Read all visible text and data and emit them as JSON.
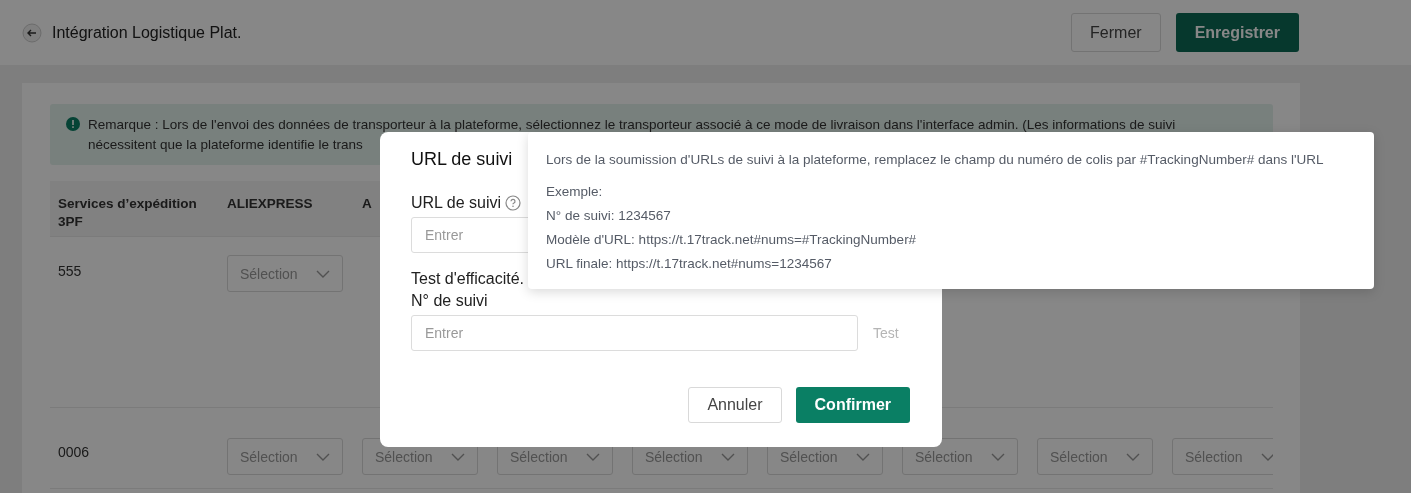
{
  "header": {
    "title": "Intégration Logistique Plat.",
    "buttons": [
      {
        "label": "Fermer",
        "kind": "secondary"
      },
      {
        "label": "Enregistrer",
        "kind": "primary"
      }
    ]
  },
  "notice": {
    "text": "Remarque : Lors de l'envoi des données de transporteur à la plateforme, sélectionnez le transporteur associé à ce mode de livraison dans l'interface admin. (Les informations de suivi nécessitent que la plateforme identifie le trans"
  },
  "table": {
    "columns": [
      "Services d’expédition 3PF",
      "ALIEXPRESS",
      "A"
    ],
    "rows": [
      {
        "cells": [
          [
            "555"
          ],
          [
            "Sélection"
          ]
        ]
      },
      {
        "cells": [
          [
            "0006"
          ],
          [
            "Sélection"
          ],
          [
            "Sélection"
          ],
          [
            "Sélection"
          ],
          [
            "Sélection"
          ],
          [
            "Sélection"
          ],
          [
            "Sélection"
          ],
          [
            "Sélection"
          ],
          [
            "Sélection"
          ]
        ]
      }
    ]
  },
  "dialog": {
    "title": "URL de suivi",
    "url_label": "URL de suivi",
    "url_placeholder": "Entrer",
    "test_heading": "Test d'efficacité.",
    "tracking_label": "N° de suivi",
    "tracking_placeholder": "Entrer",
    "test_link": "Test",
    "buttons": [
      {
        "label": "Annuler",
        "kind": "secondary"
      },
      {
        "label": "Confirmer",
        "kind": "primary"
      }
    ]
  },
  "tooltip": {
    "lines": [
      "Lors de la soumission d'URLs de suivi à la plateforme, remplacez le champ du numéro de colis par #TrackingNumber# dans l'URL",
      "Exemple:",
      "N° de suivi: 1234567",
      "Modèle d'URL: https://t.17track.net#nums=#TrackingNumber#",
      "URL finale: https://t.17track.net#nums=1234567"
    ]
  }
}
